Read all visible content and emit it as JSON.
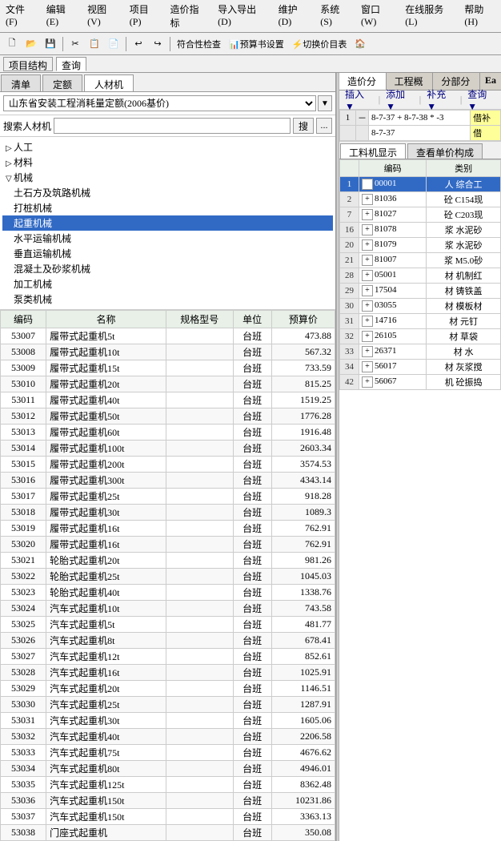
{
  "menubar": {
    "items": [
      "文件(F)",
      "编辑(E)",
      "视图(V)",
      "项目(P)",
      "造价指标",
      "导入导出(D)",
      "维护(D)",
      "系统(S)",
      "窗口(W)",
      "在线服务(L)",
      "帮助(H)"
    ]
  },
  "top_tabs": {
    "items": [
      "项目结构",
      "查询"
    ]
  },
  "left_tabs": {
    "items": [
      "清单",
      "定额",
      "人材机"
    ],
    "active": 2
  },
  "dropdown": {
    "value": "山东省安装工程消耗量定额(2006基价)",
    "placeholder": "山东省安装工程消耗量定额(2006基价)"
  },
  "search": {
    "placeholder": "搜索人材机",
    "btn_label": "搜",
    "btn2_label": "..."
  },
  "tree": {
    "items": [
      {
        "label": "人工",
        "level": 0,
        "expanded": false,
        "toggle": "▷"
      },
      {
        "label": "材料",
        "level": 0,
        "expanded": false,
        "toggle": "▷"
      },
      {
        "label": "机械",
        "level": 0,
        "expanded": true,
        "toggle": "▽"
      },
      {
        "label": "土石方及筑路机械",
        "level": 1,
        "expanded": false,
        "toggle": ""
      },
      {
        "label": "打桩机械",
        "level": 1,
        "expanded": false,
        "toggle": ""
      },
      {
        "label": "起重机械",
        "level": 1,
        "expanded": false,
        "toggle": "",
        "selected": true
      },
      {
        "label": "水平运输机械",
        "level": 1,
        "expanded": false,
        "toggle": ""
      },
      {
        "label": "垂直运输机械",
        "level": 1,
        "expanded": false,
        "toggle": ""
      },
      {
        "label": "混凝土及砂浆机械",
        "level": 1,
        "expanded": false,
        "toggle": ""
      },
      {
        "label": "加工机械",
        "level": 1,
        "expanded": false,
        "toggle": ""
      },
      {
        "label": "泵类机械",
        "level": 1,
        "expanded": false,
        "toggle": ""
      }
    ]
  },
  "table_headers": [
    "编码",
    "名称",
    "规格型号",
    "单位",
    "预算价"
  ],
  "table_rows": [
    {
      "code": "53007",
      "name": "履带式起重机5t",
      "spec": "",
      "unit": "台班",
      "price": "473.88"
    },
    {
      "code": "53008",
      "name": "履带式起重机10t",
      "spec": "",
      "unit": "台班",
      "price": "567.32"
    },
    {
      "code": "53009",
      "name": "履带式起重机15t",
      "spec": "",
      "unit": "台班",
      "price": "733.59"
    },
    {
      "code": "53010",
      "name": "履带式起重机20t",
      "spec": "",
      "unit": "台班",
      "price": "815.25"
    },
    {
      "code": "53011",
      "name": "履带式起重机40t",
      "spec": "",
      "unit": "台班",
      "price": "1519.25"
    },
    {
      "code": "53012",
      "name": "履带式起重机50t",
      "spec": "",
      "unit": "台班",
      "price": "1776.28"
    },
    {
      "code": "53013",
      "name": "履带式起重机60t",
      "spec": "",
      "unit": "台班",
      "price": "1916.48"
    },
    {
      "code": "53014",
      "name": "履带式起重机100t",
      "spec": "",
      "unit": "台班",
      "price": "2603.34"
    },
    {
      "code": "53015",
      "name": "履带式起重机200t",
      "spec": "",
      "unit": "台班",
      "price": "3574.53"
    },
    {
      "code": "53016",
      "name": "履带式起重机300t",
      "spec": "",
      "unit": "台班",
      "price": "4343.14"
    },
    {
      "code": "53017",
      "name": "履带式起重机25t",
      "spec": "",
      "unit": "台班",
      "price": "918.28"
    },
    {
      "code": "53018",
      "name": "履带式起重机30t",
      "spec": "",
      "unit": "台班",
      "price": "1089.3"
    },
    {
      "code": "53019",
      "name": "履带式起重机16t",
      "spec": "",
      "unit": "台班",
      "price": "762.91"
    },
    {
      "code": "53020",
      "name": "履带式起重机16t",
      "spec": "",
      "unit": "台班",
      "price": "762.91"
    },
    {
      "code": "53021",
      "name": "轮胎式起重机20t",
      "spec": "",
      "unit": "台班",
      "price": "981.26"
    },
    {
      "code": "53022",
      "name": "轮胎式起重机25t",
      "spec": "",
      "unit": "台班",
      "price": "1045.03"
    },
    {
      "code": "53023",
      "name": "轮胎式起重机40t",
      "spec": "",
      "unit": "台班",
      "price": "1338.76"
    },
    {
      "code": "53024",
      "name": "汽车式起重机10t",
      "spec": "",
      "unit": "台班",
      "price": "743.58"
    },
    {
      "code": "53025",
      "name": "汽车式起重机5t",
      "spec": "",
      "unit": "台班",
      "price": "481.77"
    },
    {
      "code": "53026",
      "name": "汽车式起重机8t",
      "spec": "",
      "unit": "台班",
      "price": "678.41"
    },
    {
      "code": "53027",
      "name": "汽车式起重机12t",
      "spec": "",
      "unit": "台班",
      "price": "852.61"
    },
    {
      "code": "53028",
      "name": "汽车式起重机16t",
      "spec": "",
      "unit": "台班",
      "price": "1025.91"
    },
    {
      "code": "53029",
      "name": "汽车式起重机20t",
      "spec": "",
      "unit": "台班",
      "price": "1146.51"
    },
    {
      "code": "53030",
      "name": "汽车式起重机25t",
      "spec": "",
      "unit": "台班",
      "price": "1287.91"
    },
    {
      "code": "53031",
      "name": "汽车式起重机30t",
      "spec": "",
      "unit": "台班",
      "price": "1605.06"
    },
    {
      "code": "53032",
      "name": "汽车式起重机40t",
      "spec": "",
      "unit": "台班",
      "price": "2206.58"
    },
    {
      "code": "53033",
      "name": "汽车式起重机75t",
      "spec": "",
      "unit": "台班",
      "price": "4676.62"
    },
    {
      "code": "53034",
      "name": "汽车式起重机80t",
      "spec": "",
      "unit": "台班",
      "price": "4946.01"
    },
    {
      "code": "53035",
      "name": "汽车式起重机125t",
      "spec": "",
      "unit": "台班",
      "price": "8362.48"
    },
    {
      "code": "53036",
      "name": "汽车式起重机150t",
      "spec": "",
      "unit": "台班",
      "price": "10231.86"
    },
    {
      "code": "53037",
      "name": "汽车式起重机150t",
      "spec": "",
      "unit": "台班",
      "price": "3363.13"
    },
    {
      "code": "53038",
      "name": "门座式起重机",
      "spec": "",
      "unit": "台班",
      "price": "350.08"
    }
  ],
  "right_panel": {
    "top_tabs": [
      "造价分析",
      "工程概况",
      "分部分项"
    ],
    "toolbar": {
      "items": [
        "插入▼",
        "添加▼",
        "补充▼",
        "查询▼"
      ]
    },
    "subtabs": [
      "工料机显示",
      "查看单价构成"
    ],
    "table_headers": [
      "编码",
      "类别"
    ],
    "table_rows": [
      {
        "num": "1",
        "expand": false,
        "code": "00001",
        "type": "人",
        "typename": "综合工",
        "extra": "",
        "selected": true
      },
      {
        "num": "2",
        "expand": false,
        "code": "81036",
        "type": "砼",
        "typename": "C154现",
        "extra": ""
      },
      {
        "num": "7",
        "expand": false,
        "code": "81027",
        "type": "砼",
        "typename": "C203现",
        "extra": ""
      },
      {
        "num": "16",
        "expand": false,
        "code": "81078",
        "type": "浆",
        "typename": "水泥砂",
        "extra": ""
      },
      {
        "num": "20",
        "expand": false,
        "code": "81079",
        "type": "浆",
        "typename": "水泥砂",
        "extra": ""
      },
      {
        "num": "21",
        "expand": false,
        "code": "81007",
        "type": "浆",
        "typename": "M5.0砂",
        "extra": ""
      },
      {
        "num": "28",
        "expand": false,
        "code": "05001",
        "type": "材",
        "typename": "机制红",
        "extra": ""
      },
      {
        "num": "29",
        "expand": false,
        "code": "17504",
        "type": "材",
        "typename": "铸铁盖",
        "extra": ""
      },
      {
        "num": "30",
        "expand": false,
        "code": "03055",
        "type": "材",
        "typename": "模板材",
        "extra": ""
      },
      {
        "num": "31",
        "expand": false,
        "code": "14716",
        "type": "材",
        "typename": "元钉",
        "extra": ""
      },
      {
        "num": "32",
        "expand": false,
        "code": "26105",
        "type": "材",
        "typename": "草袋",
        "extra": ""
      },
      {
        "num": "33",
        "expand": false,
        "code": "26371",
        "type": "材",
        "typename": "水",
        "extra": ""
      },
      {
        "num": "34",
        "expand": false,
        "code": "56017",
        "type": "材",
        "typename": "灰浆搅",
        "extra": ""
      },
      {
        "num": "42",
        "expand": false,
        "code": "56067",
        "type": "机",
        "typename": "砼振捣",
        "extra": ""
      }
    ],
    "right_header": {
      "code": "编码",
      "type": "类别"
    },
    "top_right_area": {
      "row1": {
        "label1": "8-7-37 + 8-7-38 * -3",
        "label2": "借补"
      },
      "row2": {
        "label1": "8-7-37",
        "label2": "借"
      }
    }
  },
  "top_right_label": "Ea"
}
